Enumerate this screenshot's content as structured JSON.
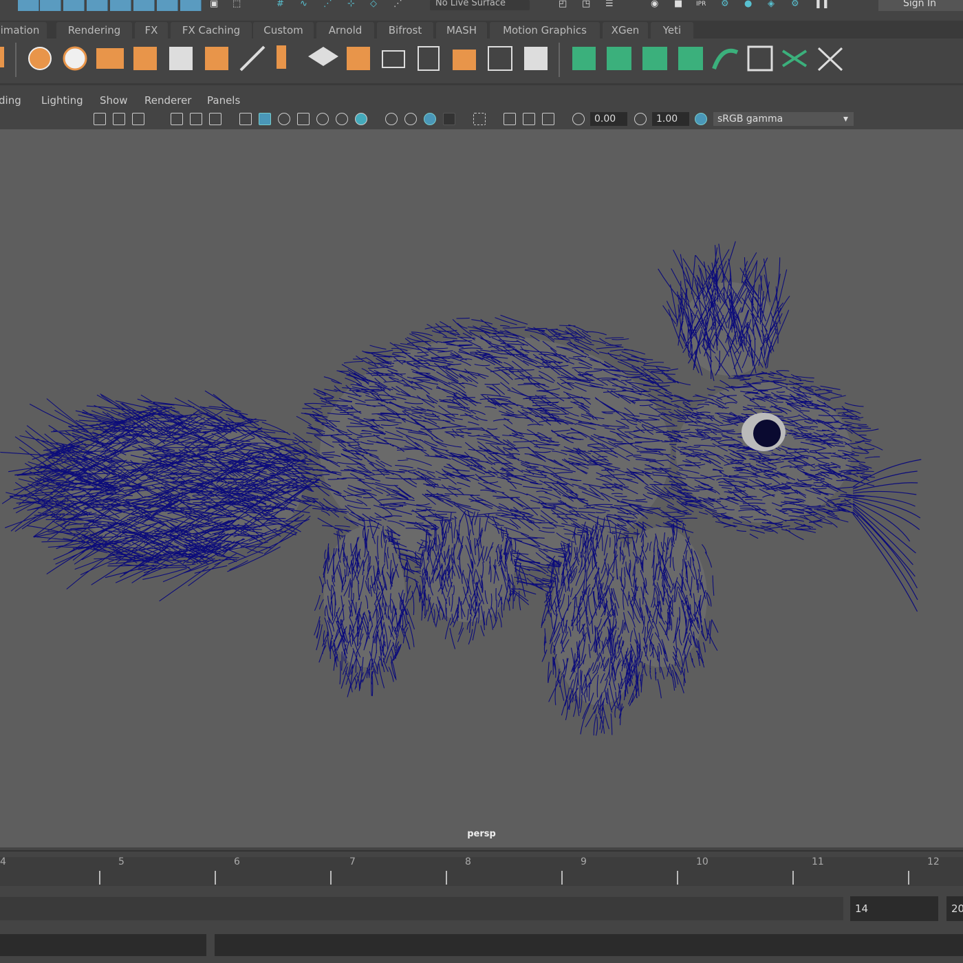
{
  "status_line": {
    "live_surface": "No Live Surface",
    "sign_in": "Sign In"
  },
  "shelf_tabs": [
    "imation",
    "Rendering",
    "FX",
    "FX Caching",
    "Custom",
    "Arnold",
    "Bifrost",
    "MASH",
    "Motion Graphics",
    "XGen",
    "Yeti"
  ],
  "panel_menu": [
    "ding",
    "Lighting",
    "Show",
    "Renderer",
    "Panels"
  ],
  "viewport_toolbar": {
    "exposure": "0.00",
    "gamma": "1.00",
    "color_space": "sRGB gamma"
  },
  "viewport": {
    "camera_label": "persp",
    "fur_color": "#0c0c7a",
    "background": "#5e5e5e"
  },
  "timeline": {
    "frames": [
      "4",
      "5",
      "6",
      "7",
      "8",
      "9",
      "10",
      "11",
      "12"
    ]
  },
  "range": {
    "current_start": "14",
    "end": "20"
  }
}
